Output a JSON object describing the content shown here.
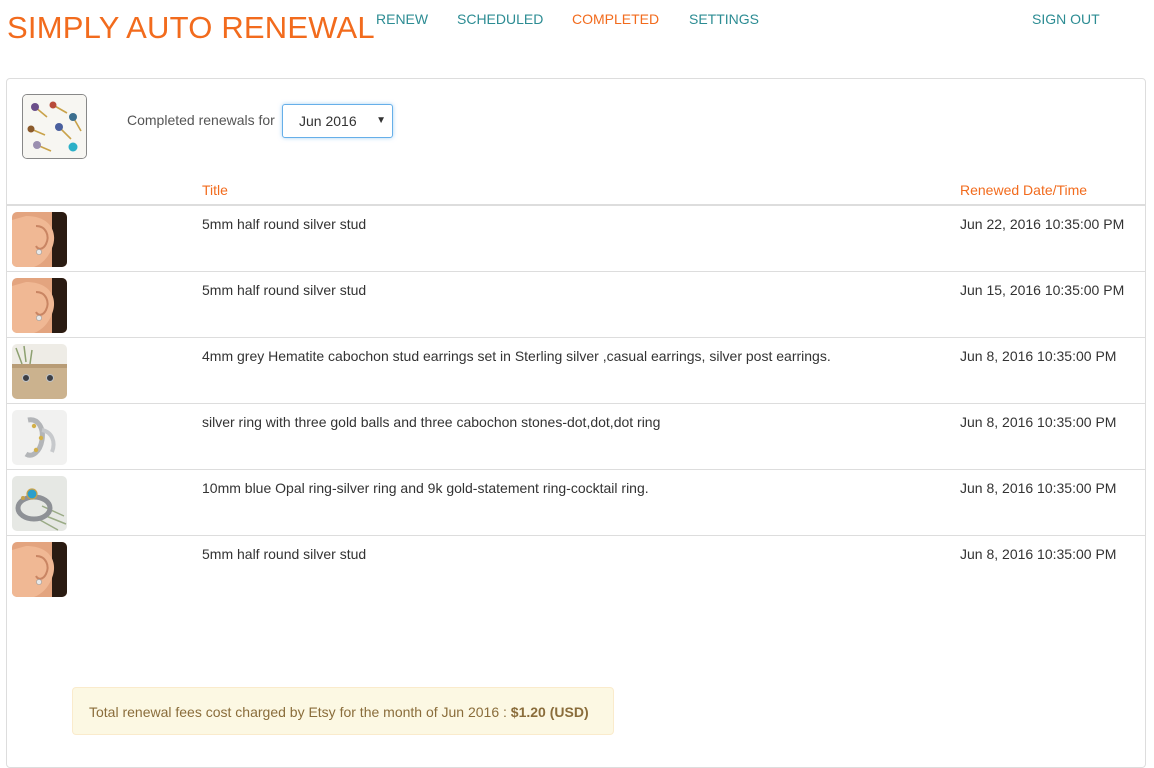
{
  "app": {
    "brand": "SIMPLY AUTO RENEWAL"
  },
  "nav": {
    "items": [
      {
        "label": "RENEW",
        "active": false
      },
      {
        "label": "SCHEDULED",
        "active": false
      },
      {
        "label": "COMPLETED",
        "active": true
      },
      {
        "label": "SETTINGS",
        "active": false
      }
    ],
    "sign_out": "SIGN OUT"
  },
  "filter": {
    "label": "Completed renewals for",
    "selected_month": "Jun 2016"
  },
  "table": {
    "headers": {
      "title": "Title",
      "date": "Renewed Date/Time"
    },
    "rows": [
      {
        "thumb": "ear-stud-photo",
        "title": "5mm half round silver stud",
        "date": "Jun 22, 2016 10:35:00 PM"
      },
      {
        "thumb": "ear-stud-photo",
        "title": "5mm half round silver stud",
        "date": "Jun 15, 2016 10:35:00 PM"
      },
      {
        "thumb": "hematite-studs-photo",
        "title": "4mm grey Hematite cabochon stud earrings set in Sterling silver ,casual earrings, silver post earrings.",
        "date": "Jun 8, 2016 10:35:00 PM"
      },
      {
        "thumb": "silver-ring-photo",
        "title": "silver ring with three gold balls and three cabochon stones-dot,dot,dot ring",
        "date": "Jun 8, 2016 10:35:00 PM"
      },
      {
        "thumb": "opal-ring-photo",
        "title": "10mm blue Opal ring-silver ring and 9k gold-statement ring-cocktail ring.",
        "date": "Jun 8, 2016 10:35:00 PM"
      },
      {
        "thumb": "ear-stud-photo",
        "title": "5mm half round silver stud",
        "date": "Jun 8, 2016 10:35:00 PM"
      }
    ]
  },
  "fees": {
    "text": "Total renewal fees cost charged by Etsy for the month of Jun 2016 : ",
    "amount": "$1.20 (USD)"
  },
  "colors": {
    "accent": "#f26b1d",
    "nav_link": "#2c8c93",
    "alert_bg": "#fcf8e3",
    "alert_text": "#8a6d3b"
  }
}
